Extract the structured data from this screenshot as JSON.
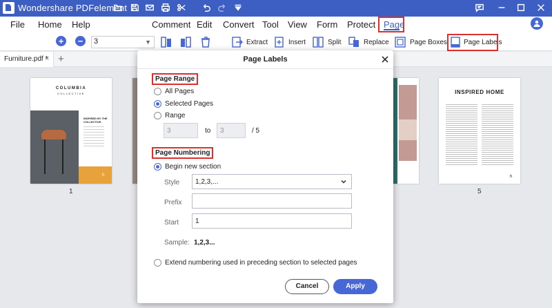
{
  "app": {
    "title": "Wondershare PDFelement",
    "titlebar_icons": [
      "folder-icon",
      "save-icon",
      "mail-icon",
      "print-icon",
      "scissors-icon",
      "undo-icon",
      "redo-icon",
      "dropdown-icon"
    ],
    "window_icons": [
      "feedback-icon",
      "minimize-icon",
      "maximize-icon",
      "close-icon"
    ]
  },
  "menu": {
    "items": [
      "File",
      "Home",
      "Help",
      "Comment",
      "Edit",
      "Convert",
      "Tool",
      "View",
      "Form",
      "Protect",
      "Page"
    ],
    "active": "Page"
  },
  "toolbar": {
    "zoom_in": "+",
    "zoom_out": "−",
    "page_value": "3",
    "tools": [
      "Extract",
      "Insert",
      "Split",
      "Replace",
      "Page Boxes",
      "Page Labels"
    ]
  },
  "tab": {
    "label": "Furniture.pdf *",
    "close": "×",
    "add": "+"
  },
  "thumbnails": {
    "page1": {
      "brand": "COLUMBIA",
      "brand_sub": "COLLECTIVE",
      "heading": "INSPIRED BY THE COLLECTIVE.",
      "corner": "h",
      "num": "1"
    },
    "page5": {
      "heading": "INSPIRED HOME",
      "corner": "h",
      "num": "5"
    }
  },
  "dialog": {
    "title": "Page Labels",
    "page_range": {
      "heading": "Page Range",
      "options": [
        "All Pages",
        "Selected Pages",
        "Range"
      ],
      "selected": "Selected Pages",
      "from": "3",
      "to_label": "to",
      "to": "3",
      "total": "/ 5"
    },
    "page_numbering": {
      "heading": "Page Numbering",
      "begin_label": "Begin new section",
      "style_label": "Style",
      "style_value": "1,2,3,...",
      "prefix_label": "Prefix",
      "prefix_value": "",
      "start_label": "Start",
      "start_value": "1",
      "sample_label": "Sample:",
      "sample_value": "1,2,3..."
    },
    "extend_label": "Extend numbering used in preceding section to selected pages",
    "cancel": "Cancel",
    "apply": "Apply"
  },
  "colors": {
    "brand": "#3d5fc4",
    "accent": "#4867d6",
    "highlight": "#d9302e",
    "thumb_accent": "#e8a23c"
  }
}
